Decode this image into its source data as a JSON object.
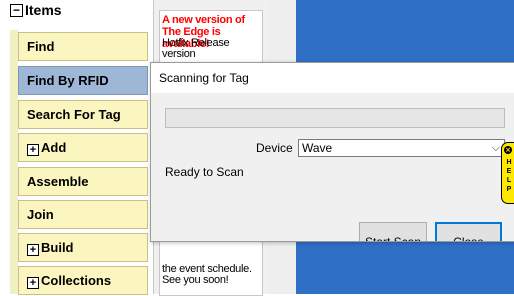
{
  "nav": {
    "root_label": "Items",
    "root_toggle": "−",
    "items": [
      {
        "label": "Find",
        "plus": ""
      },
      {
        "label": "Find By RFID",
        "plus": ""
      },
      {
        "label": "Search For Tag",
        "plus": ""
      },
      {
        "label": "Add",
        "plus": "+"
      },
      {
        "label": "Assemble",
        "plus": ""
      },
      {
        "label": "Join",
        "plus": ""
      },
      {
        "label": "Build",
        "plus": "+"
      },
      {
        "label": "Collections",
        "plus": "+"
      }
    ],
    "selected": "Find By RFID"
  },
  "notification": {
    "title": "A new version of The Edge is available!",
    "body_top": "Hotfix Release version",
    "body_bottom": "the event schedule. See you soon!"
  },
  "dialog": {
    "title": "Scanning for Tag",
    "device_label": "Device",
    "device_value": "Wave",
    "status": "Ready to Scan",
    "start_button": "Start Scan",
    "close_button": "Close"
  },
  "help_tab": {
    "label": "HELP",
    "close_glyph": "×"
  },
  "colors": {
    "nav_button": "#fbf5bf",
    "nav_selected": "#9fb7d6",
    "content_blue": "#2f6fc6",
    "notify_title": "#ff0000",
    "help_yellow": "#ffe800",
    "focus_border": "#0078d7"
  }
}
